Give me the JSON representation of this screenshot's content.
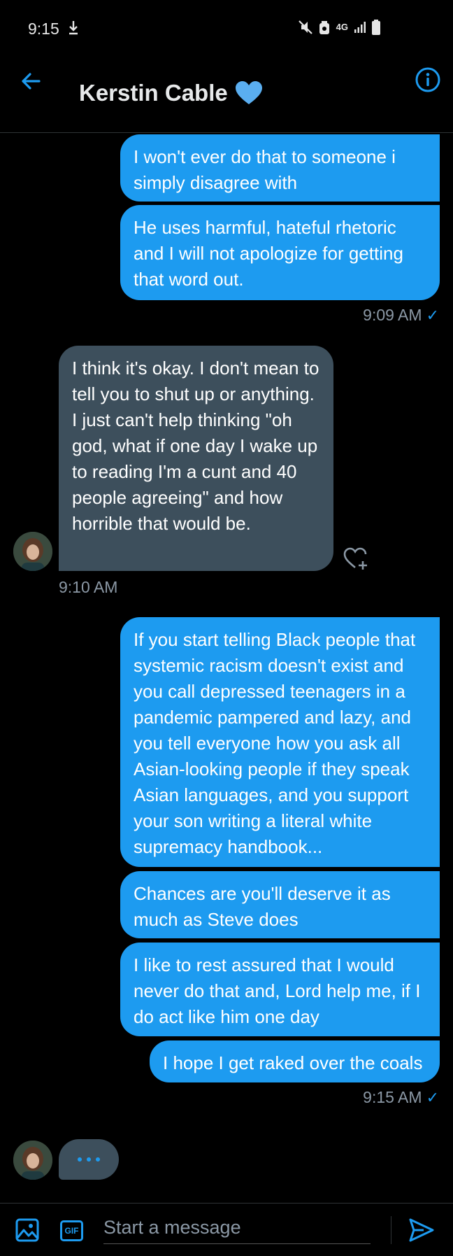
{
  "status_bar": {
    "time": "9:15",
    "network": "4G"
  },
  "header": {
    "title": "Kerstin Cable"
  },
  "messages": [
    {
      "text": "I won't ever do that to someone i simply disagree with"
    },
    {
      "text": "He uses harmful, hateful rhetoric and I will not apologize for getting that word out."
    },
    {
      "text": "I think it's okay. I don't mean to tell you to shut up or anything. I just can't help thinking \"oh god, what if one day I wake up to reading I'm a cunt and 40 people agreeing\" and how horrible that would be."
    },
    {
      "text": "If you start telling Black people that systemic racism doesn't exist and you call depressed teenagers in a pandemic pampered and lazy, and you tell everyone how you ask all Asian-looking people if they speak Asian languages, and you support your son writing a literal white supremacy handbook..."
    },
    {
      "text": "Chances are you'll deserve it as much as Steve does"
    },
    {
      "text": "I like to rest assured that I would never do that and, Lord help me, if I do act like him one day"
    },
    {
      "text": "I hope I get raked over the coals"
    }
  ],
  "timestamps": {
    "t1": "9:09 AM",
    "t2": "9:10 AM",
    "t3": "9:15 AM"
  },
  "composer": {
    "placeholder": "Start a message",
    "gif_label": "GIF"
  },
  "colors": {
    "accent": "#1d9bf0",
    "incoming_bubble": "#3d4f5c",
    "background": "#000000"
  },
  "icons": [
    "download-icon",
    "mute-icon",
    "alarm-icon",
    "signal-icon",
    "battery-icon",
    "back-arrow-icon",
    "blue-heart-icon",
    "info-icon",
    "heart-plus-icon",
    "image-icon",
    "send-icon"
  ]
}
